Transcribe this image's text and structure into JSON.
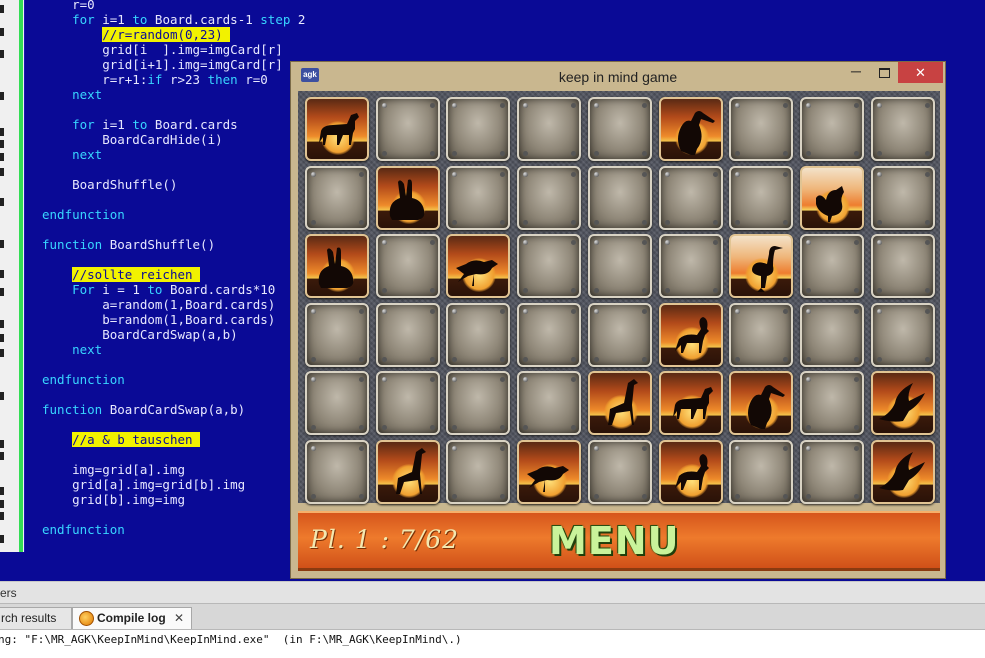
{
  "editor": {
    "lines": [
      [
        {
          "t": "    r=0"
        }
      ],
      [
        {
          "t": "    "
        },
        {
          "t": "for",
          "c": "kw"
        },
        {
          "t": " i=1 "
        },
        {
          "t": "to",
          "c": "kw"
        },
        {
          "t": " Board.cards-1 "
        },
        {
          "t": "step",
          "c": "kw"
        },
        {
          "t": " 2"
        }
      ],
      [
        {
          "t": "        "
        },
        {
          "t": "//r=random(0,23) ",
          "c": "hl"
        }
      ],
      [
        {
          "t": "        grid[i  ].img=imgCard[r]"
        }
      ],
      [
        {
          "t": "        grid[i+1].img=imgCard[r]"
        }
      ],
      [
        {
          "t": "        r=r+1:"
        },
        {
          "t": "if",
          "c": "kw"
        },
        {
          "t": " r>23 "
        },
        {
          "t": "then",
          "c": "kw"
        },
        {
          "t": " r=0"
        }
      ],
      [
        {
          "t": "    "
        },
        {
          "t": "next",
          "c": "kw"
        }
      ],
      [
        {
          "t": ""
        }
      ],
      [
        {
          "t": "    "
        },
        {
          "t": "for",
          "c": "kw"
        },
        {
          "t": " i=1 "
        },
        {
          "t": "to",
          "c": "kw"
        },
        {
          "t": " Board.cards"
        }
      ],
      [
        {
          "t": "        BoardCardHide(i)"
        }
      ],
      [
        {
          "t": "    "
        },
        {
          "t": "next",
          "c": "kw"
        }
      ],
      [
        {
          "t": ""
        }
      ],
      [
        {
          "t": "    BoardShuffle()"
        }
      ],
      [
        {
          "t": ""
        }
      ],
      [
        {
          "t": "endfunction",
          "c": "kw"
        }
      ],
      [
        {
          "t": ""
        }
      ],
      [
        {
          "t": "function",
          "c": "kw"
        },
        {
          "t": " BoardShuffle()"
        }
      ],
      [
        {
          "t": ""
        }
      ],
      [
        {
          "t": "    "
        },
        {
          "t": "//sollte reichen ",
          "c": "hl"
        }
      ],
      [
        {
          "t": "    "
        },
        {
          "t": "For",
          "c": "kw"
        },
        {
          "t": " i = 1 "
        },
        {
          "t": "to",
          "c": "kw"
        },
        {
          "t": " Board.cards*10"
        }
      ],
      [
        {
          "t": "        a=random(1,Board.cards)"
        }
      ],
      [
        {
          "t": "        b=random(1,Board.cards)"
        }
      ],
      [
        {
          "t": "        BoardCardSwap(a,b)"
        }
      ],
      [
        {
          "t": "    "
        },
        {
          "t": "next",
          "c": "kw"
        }
      ],
      [
        {
          "t": ""
        }
      ],
      [
        {
          "t": "endfunction",
          "c": "kw"
        }
      ],
      [
        {
          "t": ""
        }
      ],
      [
        {
          "t": "function",
          "c": "kw"
        },
        {
          "t": " BoardCardSwap(a,b)"
        }
      ],
      [
        {
          "t": ""
        }
      ],
      [
        {
          "t": "    "
        },
        {
          "t": "//a & b tauschen ",
          "c": "hl"
        }
      ],
      [
        {
          "t": ""
        }
      ],
      [
        {
          "t": "    img=grid[a].img"
        }
      ],
      [
        {
          "t": "    grid[a].img=grid[b].img"
        }
      ],
      [
        {
          "t": "    grid[b].img=img"
        }
      ],
      [
        {
          "t": ""
        }
      ],
      [
        {
          "t": "endfunction",
          "c": "kw"
        }
      ]
    ]
  },
  "bottom_panel": {
    "header_label": "ers",
    "tabs": {
      "search_results": "rch results",
      "compile_log": "Compile log",
      "close": "✕"
    },
    "log_line": "ng: \"F:\\MR_AGK\\KeepInMind\\KeepInMind.exe\"  (in F:\\MR_AGK\\KeepInMind\\.)"
  },
  "game_window": {
    "title": "keep in mind game",
    "app_icon": "agk",
    "minimize": "─",
    "close": "✕",
    "grid": [
      [
        "horse",
        "down",
        "down",
        "down",
        "down",
        "pelican",
        "down",
        "down",
        "down"
      ],
      [
        "down",
        "rabbit",
        "down",
        "down",
        "down",
        "down",
        "down",
        "hen",
        "down"
      ],
      [
        "rabbit",
        "down",
        "songbird",
        "down",
        "down",
        "down",
        "heron",
        "down",
        "down"
      ],
      [
        "down",
        "down",
        "down",
        "down",
        "down",
        "ibex",
        "down",
        "down",
        "down"
      ],
      [
        "down",
        "down",
        "down",
        "down",
        "giraffe",
        "horse",
        "pelican",
        "down",
        "eagle"
      ],
      [
        "down",
        "giraffe",
        "down",
        "songbird",
        "down",
        "ibex",
        "down",
        "down",
        "eagle"
      ]
    ],
    "score": "Pl. 1 : 7/62",
    "menu": "MENU"
  }
}
